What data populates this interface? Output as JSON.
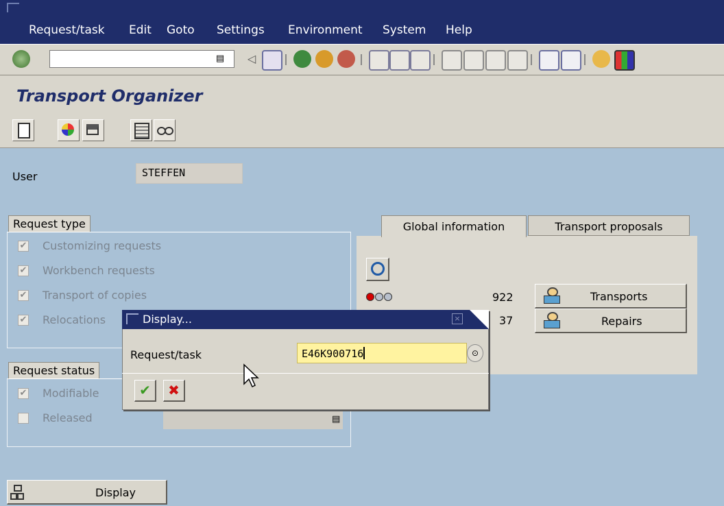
{
  "menu": {
    "items": [
      "Request/task",
      "Edit",
      "Goto",
      "Settings",
      "Environment",
      "System",
      "Help"
    ]
  },
  "toolbar": {
    "command_field_value": "",
    "icons": [
      "enter-icon",
      "back-icon",
      "save-icon",
      "back-nav-icon",
      "exit-icon",
      "cancel-icon",
      "print-icon",
      "find-icon",
      "find-next-icon",
      "first-page-icon",
      "prev-page-icon",
      "next-page-icon",
      "last-page-icon",
      "create-session-icon",
      "shortcut-icon",
      "help-icon",
      "layout-icon"
    ]
  },
  "page": {
    "title": "Transport Organizer"
  },
  "app_toolbar": {
    "icons": [
      "create-icon",
      "display-change-icon",
      "release-icon",
      "transport-tools-icon",
      "glasses-icon"
    ]
  },
  "user": {
    "label": "User",
    "value": "STEFFEN"
  },
  "request_type": {
    "title": "Request type",
    "options": [
      {
        "label": "Customizing requests",
        "checked": true
      },
      {
        "label": "Workbench requests",
        "checked": true
      },
      {
        "label": "Transport of copies",
        "checked": true
      },
      {
        "label": "Relocations",
        "checked": true
      }
    ]
  },
  "request_status": {
    "title": "Request status",
    "options": [
      {
        "label": "Modifiable",
        "checked": true
      },
      {
        "label": "Released",
        "checked": false
      }
    ]
  },
  "tabs": {
    "global": "Global information",
    "proposals": "Transport proposals"
  },
  "global_info": {
    "transports_count": "922",
    "repairs_count": "37",
    "transports_label": "Transports",
    "repairs_label": "Repairs"
  },
  "display_button": {
    "label": "Display"
  },
  "dialog": {
    "title": "Display...",
    "field_label": "Request/task",
    "field_value": "E46K900716"
  }
}
